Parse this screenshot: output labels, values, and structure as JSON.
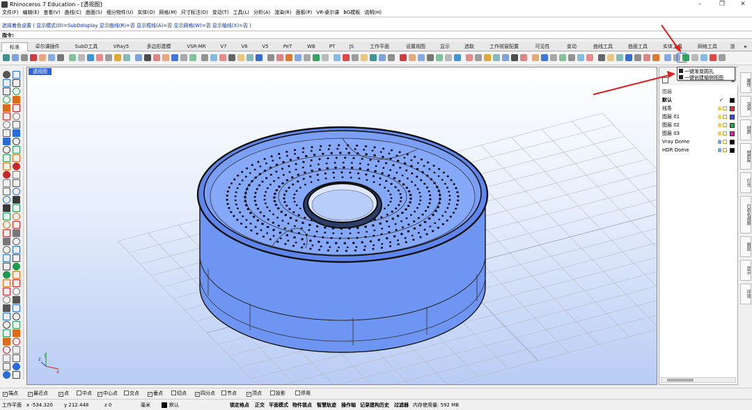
{
  "titlebar": {
    "title": "Rhinoceros 7 Education - [透视图]"
  },
  "menus": [
    "文件(F)",
    "编辑(E)",
    "查看(V)",
    "曲线(C)",
    "曲面(S)",
    "细分物件(U)",
    "实体(O)",
    "网格(M)",
    "尺寸标注(D)",
    "变动(T)",
    "工具(L)",
    "分析(A)",
    "渲染(R)",
    "面板(P)",
    "VR-桌尔课",
    "BG模板",
    "说明(H)"
  ],
  "command": {
    "history": "选择着色设置 ( 显示模式(D)=SubDdisplay  显示曲线(R)=否  显示框线(A)=否  显示网格(W)=否  显示轴线(X)=否 )",
    "prompt": "指令:"
  },
  "tabs": [
    "标准",
    "卓尔课插件",
    "SubD工具",
    "VRay5",
    "多边形建模",
    "VSR-MR",
    "V7",
    "V6",
    "V5",
    "PeT",
    "WB",
    "PT",
    "JS",
    "工作平面",
    "设置视图",
    "显示",
    "选取",
    "工作视窗配置",
    "可见性",
    "变动",
    "曲线工具",
    "曲面工具",
    "实体工具",
    "网格工具",
    "渲"
  ],
  "viewport": {
    "label": "透视图"
  },
  "popup": {
    "items": [
      "一键渐变圆孔",
      "一键创建轴侧视图"
    ]
  },
  "layers": {
    "title": "图层",
    "rows": [
      {
        "name": "默认",
        "color": "#000000",
        "current": true
      },
      {
        "name": "线条",
        "color": "#e03030"
      },
      {
        "name": "图层 01",
        "color": "#3050e0"
      },
      {
        "name": "图层 02",
        "color": "#20b040"
      },
      {
        "name": "图层 03",
        "color": "#e020a0"
      },
      {
        "name": "Vray Dome",
        "color": "#000000"
      },
      {
        "name": "HDR Dome",
        "color": "#000000"
      }
    ]
  },
  "side_tabs": [
    "属性",
    "渲染",
    "材质",
    "材质库",
    "灯光",
    "已命名视图",
    "图层",
    "显示",
    "环境"
  ],
  "osnaps": [
    {
      "label": "端点",
      "checked": true
    },
    {
      "label": "最近点",
      "checked": true
    },
    {
      "label": "点",
      "checked": true
    },
    {
      "label": "中点",
      "checked": false
    },
    {
      "label": "中心点",
      "checked": true
    },
    {
      "label": "交点",
      "checked": false
    },
    {
      "label": "垂点",
      "checked": true
    },
    {
      "label": "切点",
      "checked": false
    },
    {
      "label": "四分点",
      "checked": true
    },
    {
      "label": "节点",
      "checked": false
    },
    {
      "label": "顶点",
      "checked": true
    },
    {
      "label": "投影",
      "checked": false
    },
    {
      "label": "停用",
      "checked": false
    }
  ],
  "status": {
    "cplane": "工作平面",
    "x": "x -534.320",
    "y": "y 212.448",
    "z": "z 0",
    "unit": "毫米",
    "layer": "默认",
    "modes": [
      "锁定格点",
      "正交",
      "平面模式",
      "物件锁点",
      "智慧轨迹",
      "操作轴",
      "记录建构历史",
      "过滤器"
    ],
    "memory": "内存使用量: 592 MB"
  }
}
